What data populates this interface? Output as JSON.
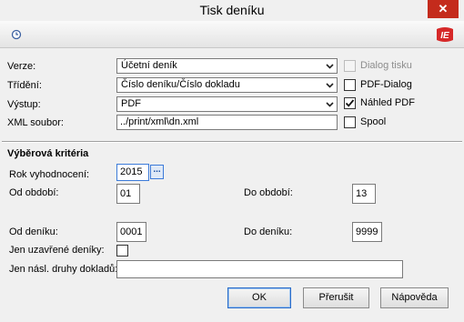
{
  "window": {
    "title": "Tisk deníku",
    "close_glyph": "✕"
  },
  "toolbar": {
    "history_icon": "clock-history-icon",
    "brand_icon": "company-logo-icon"
  },
  "form": {
    "verze_label": "Verze:",
    "verze_value": "Účetní deník",
    "trideni_label": "Třídění:",
    "trideni_value": "Číslo deníku/Číslo dokladu",
    "vystup_label": "Výstup:",
    "vystup_value": "PDF",
    "xml_label": "XML soubor:",
    "xml_value": "../print/xml\\dn.xml"
  },
  "options": {
    "dialog_tisku": {
      "label": "Dialog tisku",
      "checked": false,
      "enabled": false
    },
    "pdf_dialog": {
      "label": "PDF-Dialog",
      "checked": false,
      "enabled": true
    },
    "nahled_pdf": {
      "label": "Náhled PDF",
      "checked": true,
      "enabled": true
    },
    "spool": {
      "label": "Spool",
      "checked": false,
      "enabled": true
    }
  },
  "criteria": {
    "heading": "Výběrová kritéria",
    "rok_label": "Rok vyhodnocení:",
    "rok_value": "2015",
    "dots_label": "...",
    "od_obdobi_label": "Od období:",
    "od_obdobi_value": "01",
    "do_obdobi_label": "Do období:",
    "do_obdobi_value": "13",
    "od_deniku_label": "Od deníku:",
    "od_deniku_value": "0001",
    "do_deniku_label": "Do deníku:",
    "do_deniku_value": "9999",
    "uzavrene_label": "Jen uzavřené deníky:",
    "uzavrene_checked": false,
    "nasl_label": "Jen násl. druhy dokladů:",
    "nasl_value": ""
  },
  "buttons": {
    "ok": "OK",
    "cancel": "Přerušit",
    "help": "Nápověda"
  },
  "colors": {
    "close_red": "#c42b1c",
    "brand_red": "#d62828",
    "focus_blue": "#2a6cc9"
  }
}
